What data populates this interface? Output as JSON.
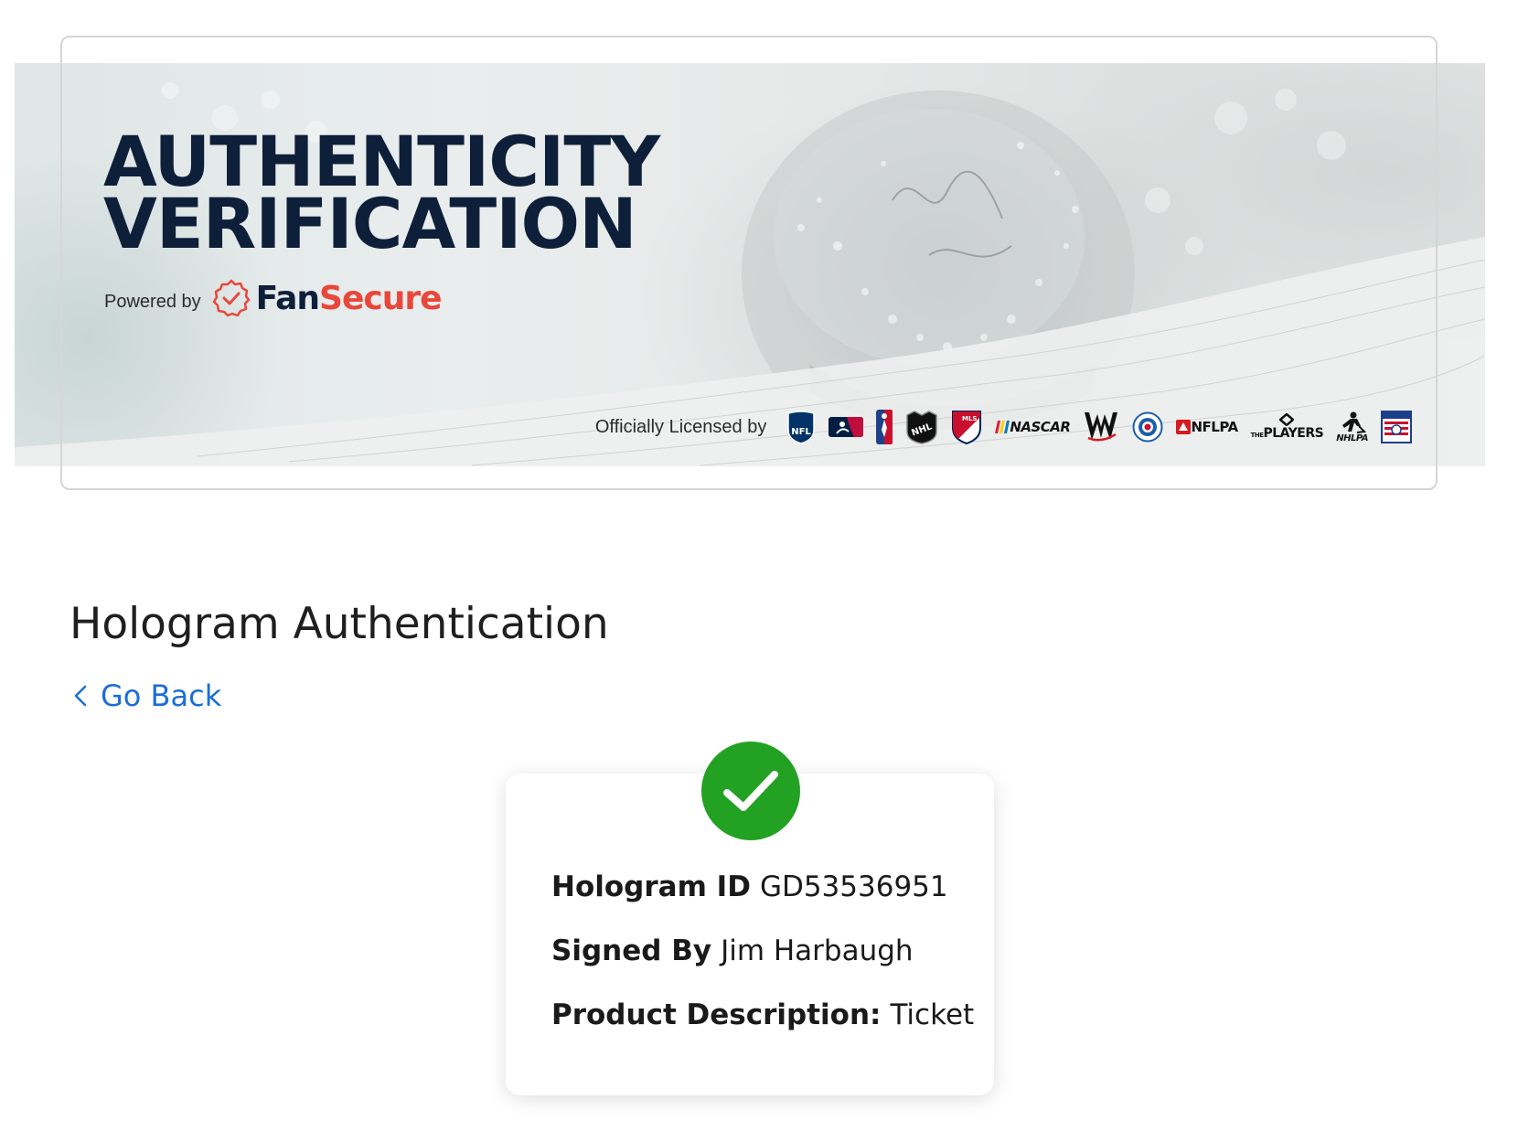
{
  "banner": {
    "title_line1": "AUTHENTICITY",
    "title_line2": "VERIFICATION",
    "powered_label": "Powered by",
    "brand_fan": "Fan",
    "brand_secure": "Secure",
    "licensed_label": "Officially Licensed by",
    "leagues": {
      "nfl": "NFL",
      "mls": "MLS",
      "nascar": "NASCAR",
      "nflpa": "NFLPA",
      "players_prefix": "THE",
      "players": "PLAYERS",
      "nhlpa": "NHLPA"
    },
    "colors": {
      "navy": "#0e1f3a",
      "red": "#e8473a"
    }
  },
  "page": {
    "title": "Hologram Authentication",
    "go_back": "Go Back"
  },
  "card": {
    "status_icon": "check-icon",
    "status_color": "#23a123",
    "fields": [
      {
        "label": "Hologram ID",
        "value": "GD53536951"
      },
      {
        "label": "Signed By",
        "value": "Jim Harbaugh"
      },
      {
        "label": "Product Description:",
        "value": "Ticket"
      }
    ]
  },
  "link_color": "#1b6ed6"
}
